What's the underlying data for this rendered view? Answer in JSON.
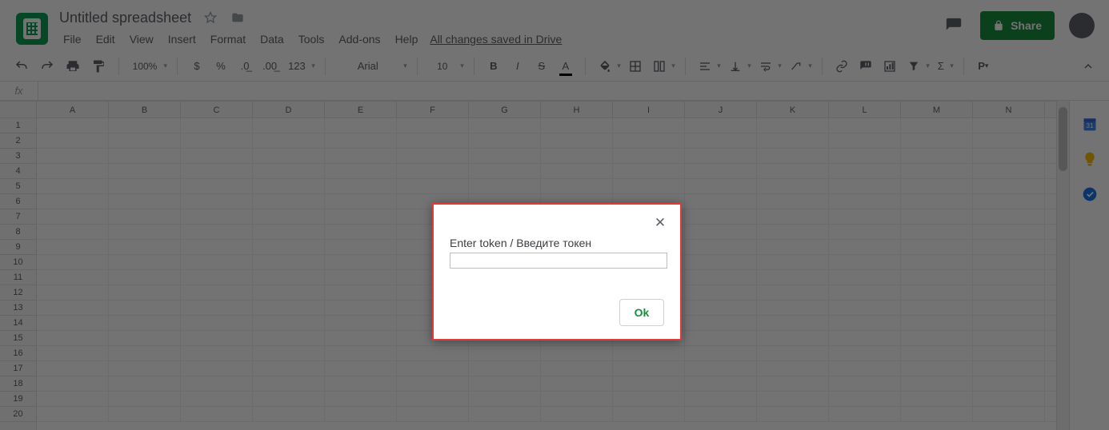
{
  "app": {
    "title": "Untitled spreadsheet",
    "save_status": "All changes saved in Drive"
  },
  "menus": {
    "file": "File",
    "edit": "Edit",
    "view": "View",
    "insert": "Insert",
    "format": "Format",
    "data": "Data",
    "tools": "Tools",
    "addons": "Add-ons",
    "help": "Help"
  },
  "share": {
    "label": "Share"
  },
  "toolbar": {
    "zoom": "100%",
    "font_name": "Arial",
    "font_size": "10",
    "number_format": "123",
    "pv": "P"
  },
  "formula": {
    "fx_label": "fx",
    "value": ""
  },
  "grid": {
    "columns": [
      "A",
      "B",
      "C",
      "D",
      "E",
      "F",
      "G",
      "H",
      "I",
      "J",
      "K",
      "L",
      "M",
      "N"
    ],
    "rows": [
      "1",
      "2",
      "3",
      "4",
      "5",
      "6",
      "7",
      "8",
      "9",
      "10",
      "11",
      "12",
      "13",
      "14",
      "15",
      "16",
      "17",
      "18",
      "19",
      "20"
    ]
  },
  "dialog": {
    "prompt": "Enter token / Введите токен",
    "value": "",
    "ok_label": "Ok"
  }
}
